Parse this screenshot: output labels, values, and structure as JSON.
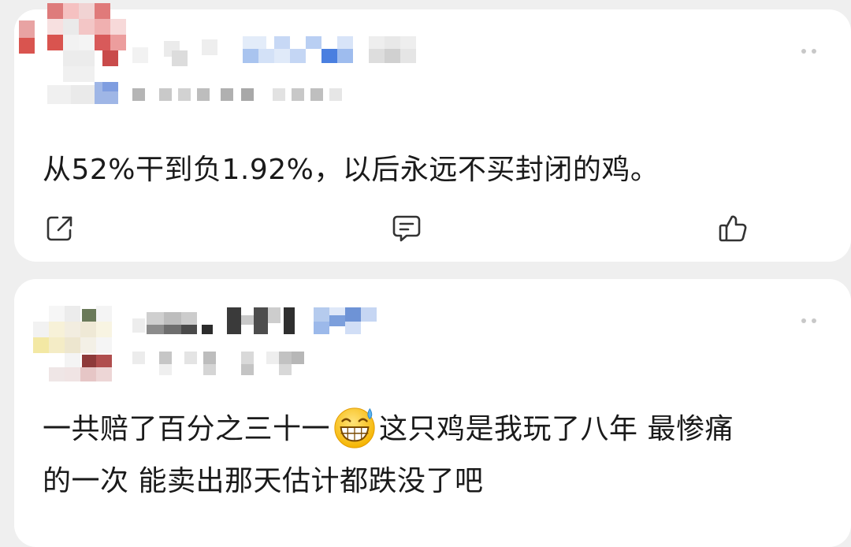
{
  "feed": {
    "comments": [
      {
        "text": "从52%干到负1.92%，以后永远不买封闭的鸡。",
        "actions": {
          "share_icon": "share-icon",
          "comment_icon": "comment-icon",
          "like_icon": "thumbs-up-icon"
        }
      },
      {
        "text_line_1_before_emoji": "一共赔了百分之三十一",
        "emoji_icon": "grinning-sweat-emoji",
        "text_line_1_after_emoji": "这只鸡是我玩了八年 最惨痛",
        "text_line_2": "的一次 能卖出那天估计都跌没了吧"
      }
    ]
  },
  "colors": {
    "background": "#efefef",
    "card": "#ffffff",
    "text": "#1a1a1a",
    "icon": "#333333",
    "more_dots": "#c8c8c8"
  }
}
